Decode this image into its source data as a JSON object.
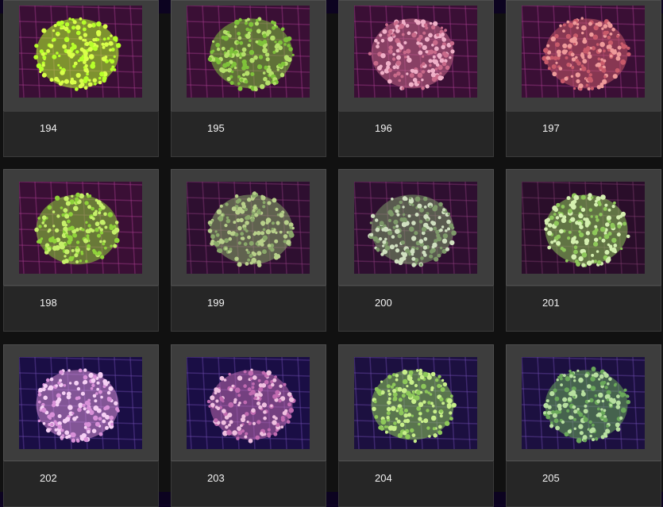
{
  "gallery": {
    "items": [
      {
        "label": "194",
        "tank": "#3a0f35",
        "coral": "#b6ff2a",
        "rim": "#d9ff4a",
        "grid": "#a23a8a"
      },
      {
        "label": "195",
        "tank": "#3a0f35",
        "coral": "#7fc23a",
        "rim": "#b5e06a",
        "grid": "#a23a8a"
      },
      {
        "label": "196",
        "tank": "#3a0f35",
        "coral": "#c96a8a",
        "rim": "#f0b0c8",
        "grid": "#a23a8a"
      },
      {
        "label": "197",
        "tank": "#3a0f35",
        "coral": "#c85a6a",
        "rim": "#ef9a9a",
        "grid": "#a23a8a"
      },
      {
        "label": "198",
        "tank": "#3a0f35",
        "coral": "#8fd23a",
        "rim": "#c6f06a",
        "grid": "#a23a8a"
      },
      {
        "label": "199",
        "tank": "#2e0f30",
        "coral": "#8aa86a",
        "rim": "#b8d08a",
        "grid": "#8a3a7a"
      },
      {
        "label": "200",
        "tank": "#2e0f30",
        "coral": "#7e9a6a",
        "rim": "#d0e0c0",
        "grid": "#8a3a7a"
      },
      {
        "label": "201",
        "tank": "#2a0e2a",
        "coral": "#8ec85a",
        "rim": "#d5f0b0",
        "grid": "#7a3a6a"
      },
      {
        "label": "202",
        "tank": "#1a0e45",
        "coral": "#d890d8",
        "rim": "#f6d0f4",
        "grid": "#6a4aa8"
      },
      {
        "label": "203",
        "tank": "#1a0e45",
        "coral": "#c06ab0",
        "rim": "#f0c0e0",
        "grid": "#6a4aa8"
      },
      {
        "label": "204",
        "tank": "#1c1040",
        "coral": "#8ec85a",
        "rim": "#c8ef8a",
        "grid": "#6a4aa8"
      },
      {
        "label": "205",
        "tank": "#1c1040",
        "coral": "#6aa85a",
        "rim": "#b8e0a0",
        "grid": "#6a4aa8"
      }
    ]
  }
}
